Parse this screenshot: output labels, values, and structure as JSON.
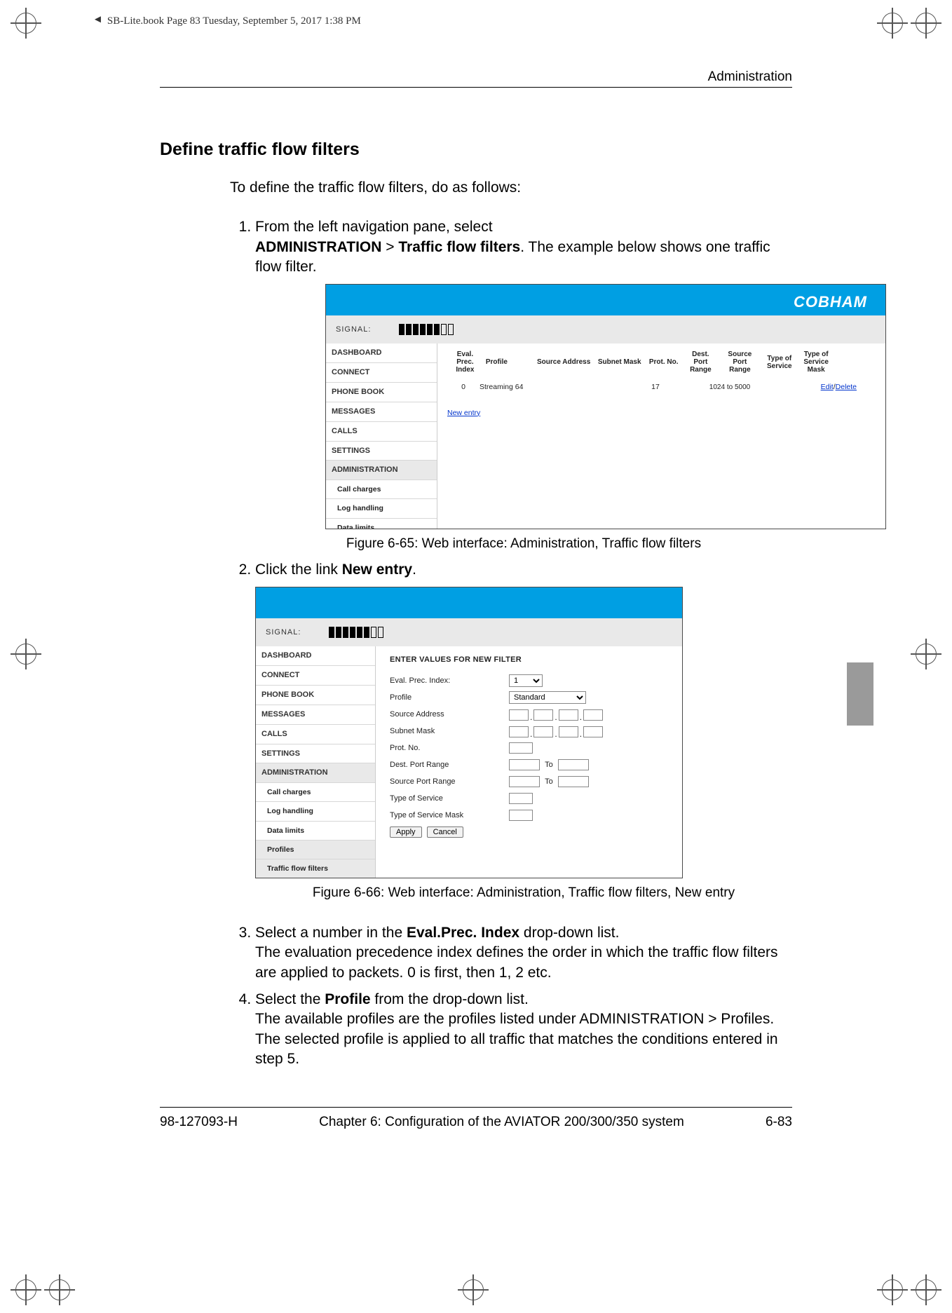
{
  "book_info": "SB-Lite.book  Page 83  Tuesday, September 5, 2017  1:38 PM",
  "section_label": "Administration",
  "h2": "Define traffic flow filters",
  "intro": "To define the traffic flow filters, do as follows:",
  "step1_a": "From the left navigation pane, select",
  "step1_b1": "ADMINISTRATION",
  "step1_b2": " > ",
  "step1_b3": "Traffic flow filters",
  "step1_c": ". The example below shows one traffic flow filter.",
  "fig1_caption": "Figure 6-65: Web interface: Administration, Traffic flow filters",
  "step2_a": "Click the link ",
  "step2_b": "New entry",
  "step2_c": ".",
  "fig2_caption": "Figure 6-66: Web interface: Administration, Traffic flow filters, New entry",
  "step3_a": "Select a number in the ",
  "step3_b1": "Eval.Prec.",
  "step3_b2": " Index",
  "step3_c": " drop-down list.",
  "step3_d": "The evaluation precedence index defines the order in which the traffic flow filters are applied to packets. 0 is first, then 1, 2 etc.",
  "step4_a": "Select the ",
  "step4_b": "Profile",
  "step4_c": " from the drop-down list.",
  "step4_d": "The available profiles are the profiles listed under ADMINISTRATION > Profiles. The selected profile is applied to all traffic that matches the conditions entered in step 5.",
  "footer_left": "98-127093-H",
  "footer_center": "Chapter 6:  Configuration of the AVIATOR 200/300/350 system",
  "footer_right": "6-83",
  "shot_common": {
    "signal_label": "SIGNAL:",
    "logo": "COBHAM"
  },
  "nav_main": [
    "DASHBOARD",
    "CONNECT",
    "PHONE BOOK",
    "MESSAGES",
    "CALLS",
    "SETTINGS",
    "ADMINISTRATION"
  ],
  "nav_sub": [
    "Call charges",
    "Log handling",
    "Data limits",
    "Profiles",
    "Traffic flow filters"
  ],
  "shot1": {
    "hdr": [
      "Eval.\nPrec.\nIndex",
      "Profile",
      "Source Address",
      "Subnet Mask",
      "Prot. No.",
      "Dest.\nPort\nRange",
      "Source\nPort\nRange",
      "Type\nof\nService",
      "Type\nof\nService\nMask",
      ""
    ],
    "row": {
      "idx": "0",
      "profile": "Streaming 64",
      "src": "",
      "mask": "",
      "prot": "17",
      "dport": "",
      "sport": "1024 to 5000",
      "tos": "",
      "tosmask": "",
      "edit": "Edit",
      "sep": "/",
      "del": "Delete"
    },
    "newentry": "New entry"
  },
  "shot2": {
    "title": "ENTER VALUES FOR NEW FILTER",
    "labels": {
      "idx": "Eval. Prec. Index:",
      "profile": "Profile",
      "src": "Source Address",
      "mask": "Subnet Mask",
      "prot": "Prot. No.",
      "dport": "Dest. Port Range",
      "sport": "Source Port Range",
      "tos": "Type of Service",
      "tosmask": "Type of Service Mask",
      "to": "To"
    },
    "values": {
      "idx": "1",
      "profile": "Standard"
    },
    "buttons": {
      "apply": "Apply",
      "cancel": "Cancel"
    }
  }
}
